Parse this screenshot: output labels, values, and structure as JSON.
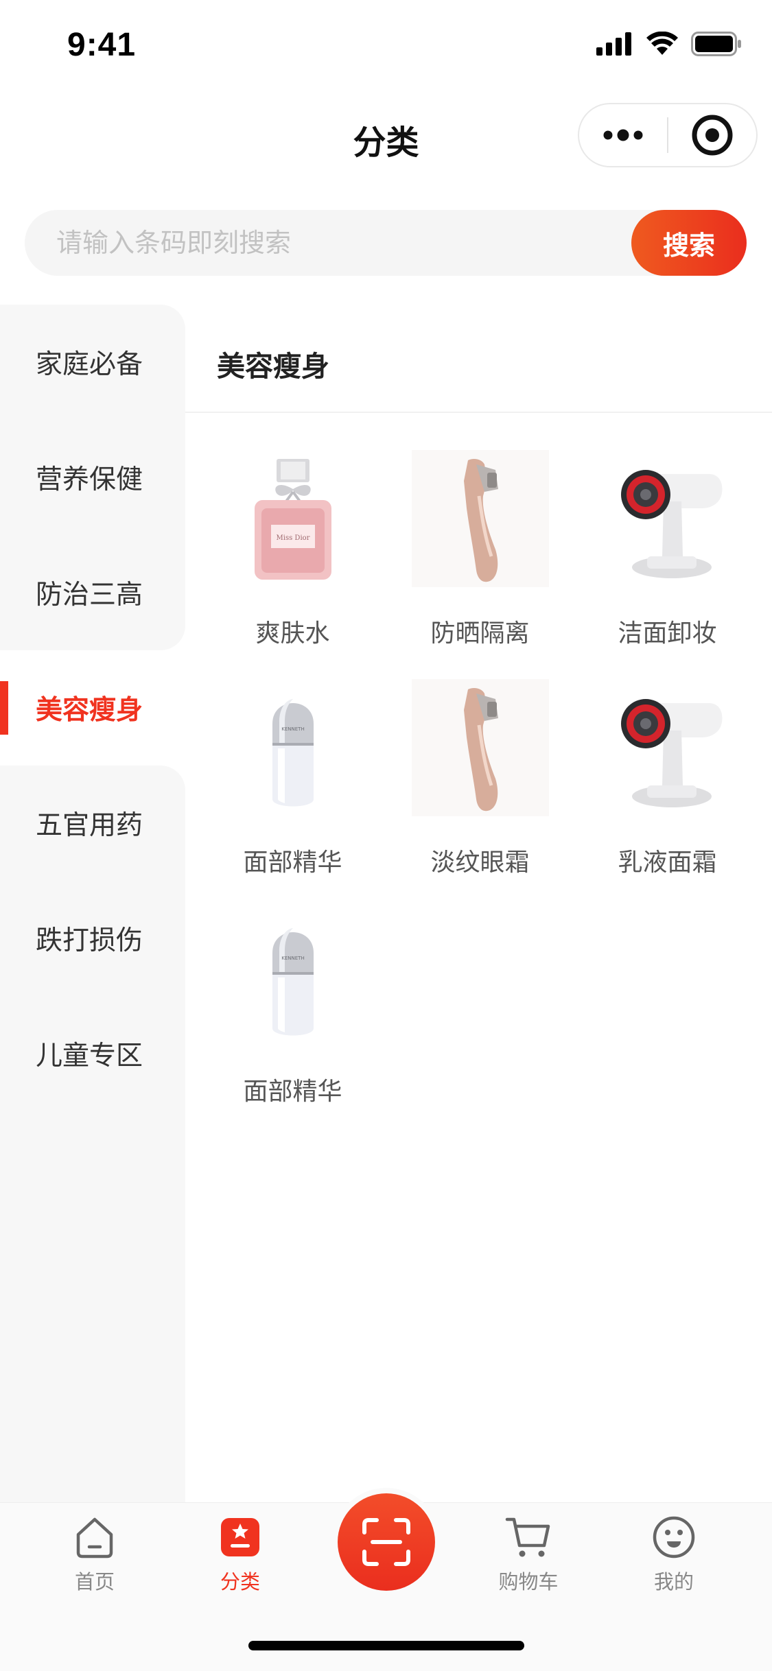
{
  "status_bar": {
    "time": "9:41"
  },
  "nav": {
    "title": "分类"
  },
  "search": {
    "placeholder": "请输入条码即刻搜索",
    "button_label": "搜索"
  },
  "sidebar": {
    "items": [
      {
        "label": "家庭必备"
      },
      {
        "label": "营养保健"
      },
      {
        "label": "防治三高"
      },
      {
        "label": "美容瘦身",
        "active": true
      },
      {
        "label": "五官用药"
      },
      {
        "label": "跌打损伤"
      },
      {
        "label": "儿童专区"
      }
    ]
  },
  "content": {
    "section_title": "美容瘦身",
    "products": [
      {
        "label": "爽肤水",
        "image": "perfume-bottle"
      },
      {
        "label": "防晒隔离",
        "image": "beauty-device"
      },
      {
        "label": "洁面卸妆",
        "image": "facial-cleanser-device"
      },
      {
        "label": "面部精华",
        "image": "serum-bottle"
      },
      {
        "label": "淡纹眼霜",
        "image": "beauty-device"
      },
      {
        "label": "乳液面霜",
        "image": "facial-cleanser-device"
      },
      {
        "label": "面部精华",
        "image": "serum-bottle"
      }
    ]
  },
  "tab_bar": {
    "items": [
      {
        "label": "首页",
        "icon": "home-icon"
      },
      {
        "label": "分类",
        "icon": "category-icon",
        "active": true
      },
      {
        "label": "",
        "icon": "scan-icon"
      },
      {
        "label": "购物车",
        "icon": "cart-icon"
      },
      {
        "label": "我的",
        "icon": "profile-icon"
      }
    ]
  },
  "colors": {
    "accent": "#f0331f",
    "search_gradient_start": "#ef5a1f",
    "sidebar_bg": "#f7f7f7"
  }
}
